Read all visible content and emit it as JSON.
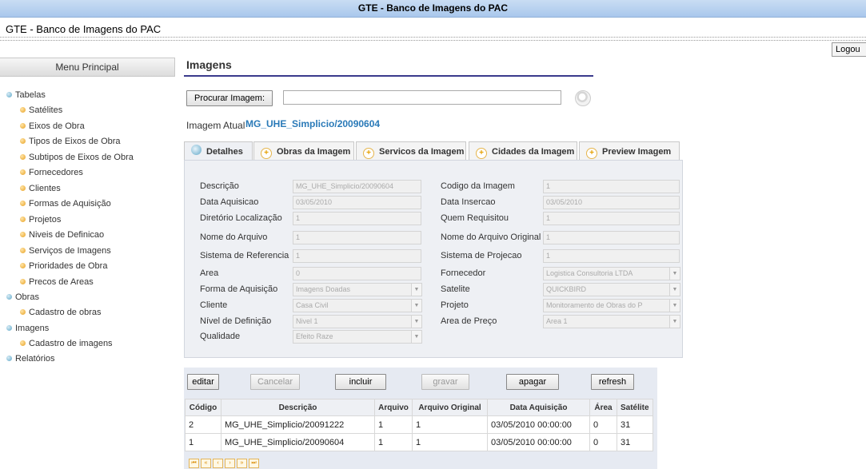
{
  "window": {
    "title": "GTE - Banco de Imagens do PAC"
  },
  "app": {
    "title": "GTE - Banco de Imagens do PAC",
    "logout": "Logou"
  },
  "sidebar": {
    "header": "Menu Principal",
    "items": [
      {
        "label": "Tabelas",
        "level": 0
      },
      {
        "label": "Satélites",
        "level": 1
      },
      {
        "label": "Eixos de Obra",
        "level": 1
      },
      {
        "label": "Tipos de Eixos de Obra",
        "level": 1
      },
      {
        "label": "Subtipos de Eixos de Obra",
        "level": 1
      },
      {
        "label": "Fornecedores",
        "level": 1
      },
      {
        "label": "Clientes",
        "level": 1
      },
      {
        "label": "Formas de Aquisição",
        "level": 1
      },
      {
        "label": "Projetos",
        "level": 1
      },
      {
        "label": "Niveis de Definicao",
        "level": 1
      },
      {
        "label": "Serviços de Imagens",
        "level": 1
      },
      {
        "label": "Prioridades de Obra",
        "level": 1
      },
      {
        "label": "Precos de Areas",
        "level": 1
      },
      {
        "label": "Obras",
        "level": 0
      },
      {
        "label": "Cadastro de obras",
        "level": 1
      },
      {
        "label": "Imagens",
        "level": 0
      },
      {
        "label": "Cadastro de imagens",
        "level": 1
      },
      {
        "label": "Relatórios",
        "level": 0
      }
    ]
  },
  "main": {
    "title": "Imagens",
    "search_button": "Procurar Imagem:",
    "search_value": "",
    "current_label": "Imagem Atual",
    "current_value": "MG_UHE_Simplicio/20090604",
    "tabs": [
      {
        "label": "Detalhes",
        "active": true
      },
      {
        "label": "Obras da Imagem",
        "active": false
      },
      {
        "label": "Servicos da Imagem",
        "active": false
      },
      {
        "label": "Cidades da Imagem",
        "active": false
      },
      {
        "label": "Preview Imagem",
        "active": false
      }
    ],
    "fields_left": [
      {
        "label": "Descrição",
        "value": "MG_UHE_Simplicio/20090604",
        "select": false
      },
      {
        "label": "Data Aquisicao",
        "value": "03/05/2010",
        "select": false
      },
      {
        "label": "Diretório Localização",
        "value": "1",
        "select": false
      },
      {
        "label": "Nome do Arquivo",
        "value": "1",
        "select": false
      },
      {
        "label": "Sistema de Referencia",
        "value": "1",
        "select": false
      },
      {
        "label": "Area",
        "value": "0",
        "select": false
      },
      {
        "label": "Forma de Aquisição",
        "value": "Imagens Doadas",
        "select": true
      },
      {
        "label": "Cliente",
        "value": "Casa Civil",
        "select": true
      },
      {
        "label": "Nível de Definição",
        "value": "Nivel 1",
        "select": true
      },
      {
        "label": "Qualidade",
        "value": "Efeito Raze",
        "select": true
      }
    ],
    "fields_right": [
      {
        "label": "Codigo da Imagem",
        "value": "1",
        "select": false
      },
      {
        "label": "Data Insercao",
        "value": "03/05/2010",
        "select": false
      },
      {
        "label": "Quem Requisitou",
        "value": "1",
        "select": false
      },
      {
        "label": "Nome do Arquivo Original",
        "value": "1",
        "select": false
      },
      {
        "label": "Sistema de Projecao",
        "value": "1",
        "select": false
      },
      {
        "label": "Fornecedor",
        "value": "Logistica Consultoria LTDA",
        "select": true
      },
      {
        "label": "Satelite",
        "value": "QUICKBIRD",
        "select": true
      },
      {
        "label": "Projeto",
        "value": "Monitoramento de Obras do P",
        "select": true
      },
      {
        "label": "Area de Preço",
        "value": "Area 1",
        "select": true
      }
    ],
    "actions": {
      "edit": "editar",
      "cancel": "Cancelar",
      "include": "incluir",
      "save": "gravar",
      "delete": "apagar",
      "refresh": "refresh"
    },
    "table": {
      "headers": [
        "Código",
        "Descrição",
        "Arquivo",
        "Arquivo Original",
        "Data Aquisição",
        "Área",
        "Satélite"
      ],
      "rows": [
        [
          "2",
          "MG_UHE_Simplicio/20091222",
          "1",
          "1",
          "03/05/2010 00:00:00",
          "0",
          "31"
        ],
        [
          "1",
          "MG_UHE_Simplicio/20090604",
          "1",
          "1",
          "03/05/2010 00:00:00",
          "0",
          "31"
        ]
      ]
    },
    "pager": [
      "first-page-icon",
      "prev-group-icon",
      "prev-page-icon",
      "next-page-icon",
      "next-group-icon",
      "last-page-icon"
    ],
    "pager_glyphs": [
      "⏮",
      "«",
      "‹",
      "›",
      "»",
      "⏭"
    ]
  }
}
